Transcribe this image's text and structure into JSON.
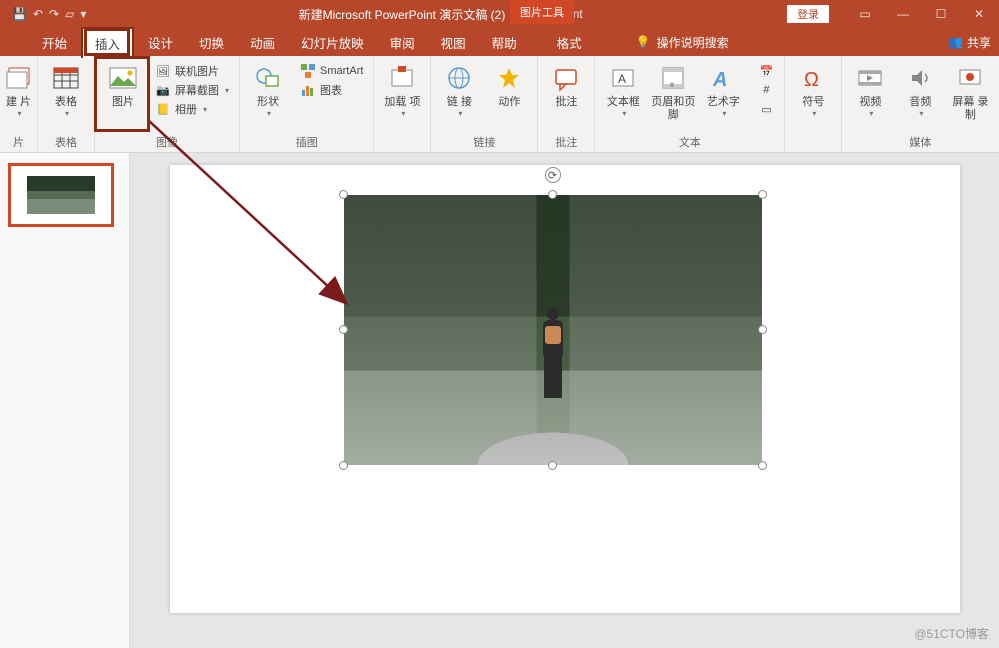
{
  "titlebar": {
    "doc_name": "新建Microsoft PowerPoint 演示文稿 (2)",
    "app_suffix": "PowerPoint",
    "tool_tab": "图片工具",
    "login": "登录"
  },
  "tabs": {
    "start": "开始",
    "insert": "插入",
    "design": "设计",
    "transition": "切换",
    "animation": "动画",
    "slideshow": "幻灯片放映",
    "review": "审阅",
    "view": "视图",
    "help": "帮助",
    "format": "格式",
    "tell_me": "操作说明搜索",
    "share": "共享"
  },
  "ribbon": {
    "groups": {
      "slides": {
        "new_slide": "建\n片",
        "label": "片"
      },
      "tables": {
        "table": "表格",
        "label": "表格"
      },
      "images": {
        "picture": "图片",
        "online_pic": "联机图片",
        "screenshot": "屏幕截图",
        "album": "相册",
        "label": "图像"
      },
      "illustrations": {
        "shapes": "形状",
        "smartart": "SmartArt",
        "chart": "图表",
        "label": "插图"
      },
      "addins": {
        "addins": "加载\n项",
        "label": ""
      },
      "links": {
        "link": "链\n接",
        "action": "动作",
        "label": "链接"
      },
      "comments": {
        "comment": "批注",
        "label": "批注"
      },
      "text": {
        "textbox": "文本框",
        "header_footer": "页眉和页脚",
        "wordart": "艺术字",
        "label": "文本"
      },
      "symbols": {
        "symbol": "符号",
        "label": ""
      },
      "media": {
        "video": "视频",
        "audio": "音频",
        "screen_rec": "屏幕\n录制",
        "label": "媒体"
      }
    }
  },
  "watermark": "@51CTO博客"
}
